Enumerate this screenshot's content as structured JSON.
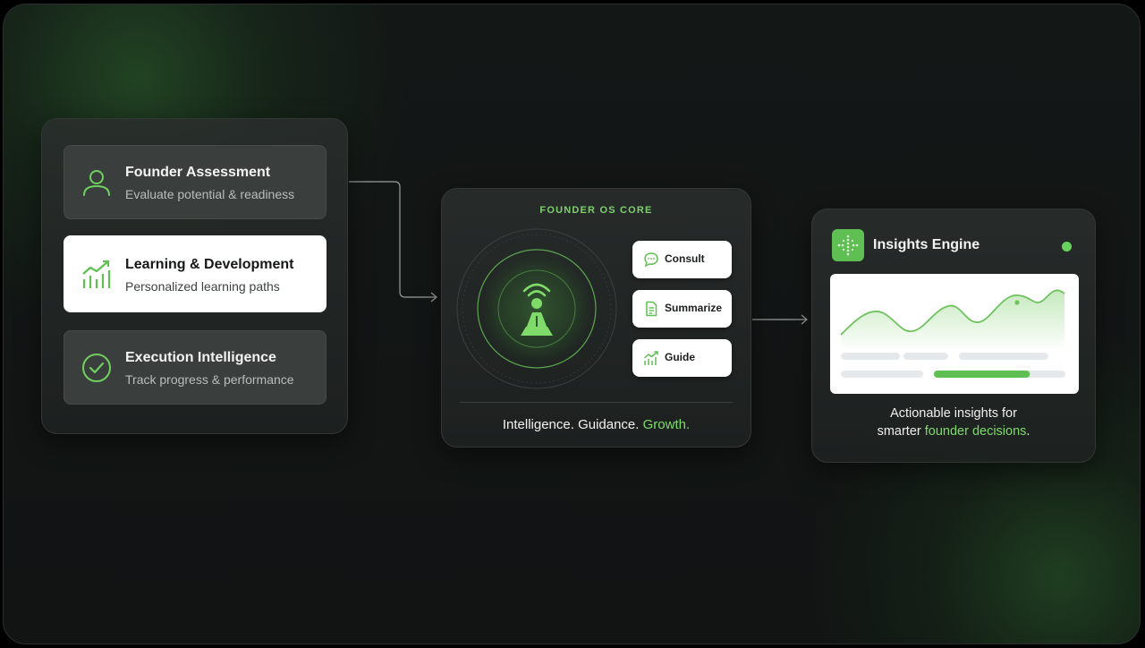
{
  "left_panel": {
    "items": [
      {
        "title": "Founder Assessment",
        "subtitle": "Evaluate potential & readiness",
        "icon": "user-icon",
        "active": false
      },
      {
        "title": "Learning & Development",
        "subtitle": "Personalized learning paths",
        "icon": "growth-chart-icon",
        "active": true
      },
      {
        "title": "Execution Intelligence",
        "subtitle": "Track progress & performance",
        "icon": "check-circle-icon",
        "active": false
      }
    ]
  },
  "core": {
    "label": "FOUNDER OS CORE",
    "center_icon": "ai-agent-icon",
    "actions": [
      {
        "label": "Consult",
        "icon": "chat-bubble-icon"
      },
      {
        "label": "Summarize",
        "icon": "document-icon"
      },
      {
        "label": "Guide",
        "icon": "trend-chart-icon"
      }
    ],
    "tagline": {
      "part1": "Intelligence. Guidance. ",
      "part2": "Growth."
    }
  },
  "insights": {
    "title": "Insights Engine",
    "logo_icon": "sparkle-grid-icon",
    "status_icon": "status-dot-icon",
    "caption": {
      "line1": "Actionable insights for",
      "line2_prefix": "smarter ",
      "line2_accent": "founder decisions",
      "line2_suffix": "."
    },
    "progress": 0.73
  },
  "colors": {
    "accent": "#7fdc6a",
    "accent_dark": "#5fbf52",
    "panel": "#2a2e2d",
    "background": "#121615"
  }
}
